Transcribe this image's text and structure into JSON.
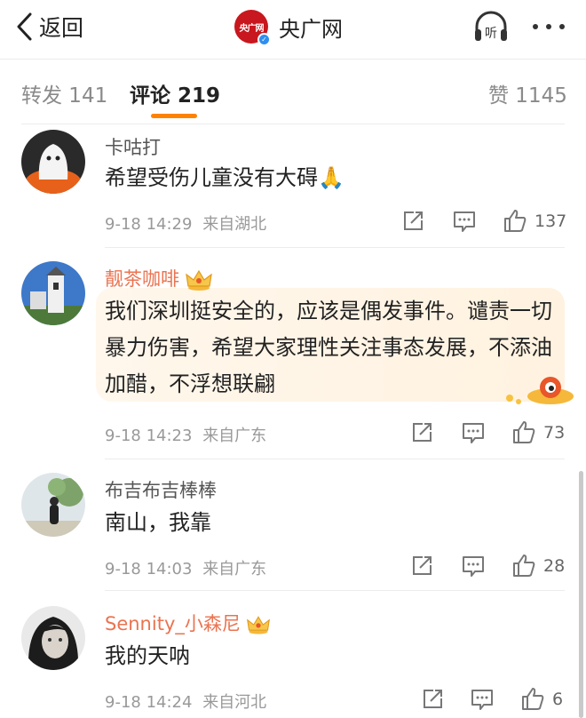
{
  "header": {
    "back_label": "返回",
    "title": "央广网",
    "logo_text": "央广网",
    "listen_label": "听"
  },
  "tabs": [
    {
      "label": "转发 141"
    },
    {
      "label": "评论 219"
    },
    {
      "label": "赞 1145"
    }
  ],
  "comments": [
    {
      "user": "卡咕打",
      "text": "希望受伤儿童没有大碍🙏",
      "time": "9-18 14:29",
      "location": "来自湖北",
      "likes": "137",
      "vip": false
    },
    {
      "user": "靓茶咖啡",
      "text": "我们深圳挺安全的，应该是偶发事件。谴责一切暴力伤害，希望大家理性关注事态发展，不添油加醋，不浮想联翩",
      "time": "9-18 14:23",
      "location": "来自广东",
      "likes": "73",
      "vip": true
    },
    {
      "user": "布吉布吉棒棒",
      "text": "南山，我靠",
      "time": "9-18 14:03",
      "location": "来自广东",
      "likes": "28",
      "vip": false
    },
    {
      "user": "Sennity_小森尼",
      "text": "我的天呐",
      "time": "9-18 14:24",
      "location": "来自河北",
      "likes": "6",
      "vip": true
    }
  ],
  "colors": {
    "accent": "#ff8200",
    "vip_name": "#eb7350",
    "brand_red": "#c8171e",
    "verify_blue": "#2d8ef0"
  },
  "icons": {
    "back": "chevron-left-icon",
    "listen": "headphones-icon",
    "more": "more-dots-icon",
    "repost": "repost-icon",
    "comment": "comment-icon",
    "like": "thumbs-up-icon",
    "crown": "crown-icon"
  }
}
